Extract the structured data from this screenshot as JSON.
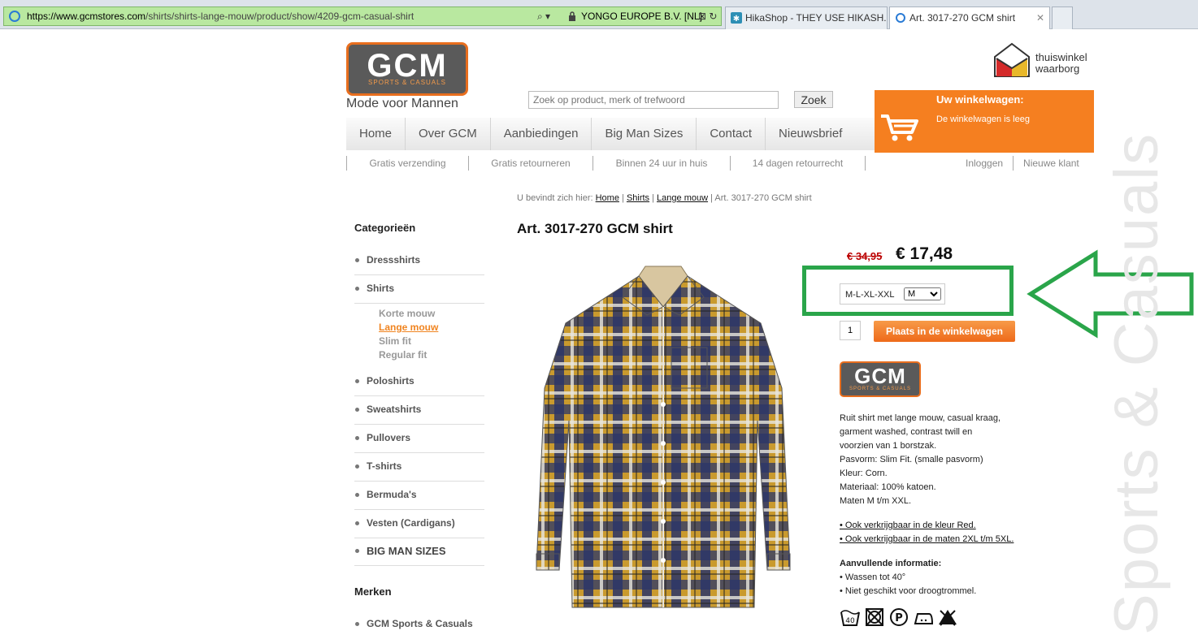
{
  "browser": {
    "url_host": "https://www.gcmstores.com",
    "url_path": "/shirts/shirts-lange-mouw/product/show/4209-gcm-casual-shirt",
    "cert": "YONGO EUROPE B.V. [NL]",
    "tabs": [
      {
        "label": "HikaShop - THEY USE HIKASH..."
      },
      {
        "label": "Art. 3017-270 GCM shirt"
      }
    ]
  },
  "header": {
    "logo_text": "GCM",
    "logo_sub": "SPORTS & CASUALS",
    "tagline": "Mode voor Mannen",
    "search_placeholder": "Zoek op product, merk of trefwoord",
    "search_button": "Zoek",
    "thuiswinkel_line1": "thuiswinkel",
    "thuiswinkel_line2": "waarborg"
  },
  "cart": {
    "title": "Uw winkelwagen:",
    "empty": "De winkelwagen is leeg"
  },
  "nav": [
    "Home",
    "Over GCM",
    "Aanbiedingen",
    "Big Man Sizes",
    "Contact",
    "Nieuwsbrief"
  ],
  "usp": [
    "Gratis verzending",
    "Gratis retourneren",
    "Binnen 24 uur in huis",
    "14 dagen retourrecht"
  ],
  "account": [
    "Inloggen",
    "Nieuwe klant"
  ],
  "breadcrumb": {
    "prefix": "U bevindt zich hier:",
    "links": [
      "Home",
      "Shirts",
      "Lange mouw"
    ],
    "current": "Art. 3017-270 GCM shirt"
  },
  "sidebar": {
    "title": "Categorieën",
    "categories": [
      "Dressshirts",
      "Shirts",
      "Poloshirts",
      "Sweatshirts",
      "Pullovers",
      "T-shirts",
      "Bermuda's",
      "Vesten (Cardigans)",
      "BIG MAN SIZES"
    ],
    "subcategories": [
      "Korte mouw",
      "Lange mouw",
      "Slim fit",
      "Regular fit"
    ],
    "brands_title": "Merken",
    "brands": [
      "GCM Sports & Casuals"
    ]
  },
  "product": {
    "title": "Art. 3017-270 GCM shirt",
    "old_price": "€ 34,95",
    "new_price": "€ 17,48",
    "size_label": "M-L-XL-XXL",
    "size_selected": "M",
    "quantity": "1",
    "add_button": "Plaats in de winkelwagen",
    "description": [
      "Ruit shirt met lange mouw, casual kraag,",
      "garment washed, contrast twill en",
      "voorzien van 1 borstzak.",
      "Pasvorm: Slim Fit. (smalle pasvorm)",
      "Kleur: Corn.",
      "Materiaal: 100% katoen.",
      "Maten M t/m XXL."
    ],
    "links": [
      "• Ook verkrijgbaar in de kleur Red.",
      "• Ook verkrijgbaar in de maten 2XL t/m 5XL."
    ],
    "extra_title": "Aanvullende informatie:",
    "extra": [
      "• Wassen tot 40°",
      "• Niet geschikt voor droogtrommel."
    ],
    "care_wash_temp": "40"
  },
  "watermark": "Sports & Casuals",
  "colors": {
    "accent_orange": "#f57f20",
    "highlight_green": "#2aa54a",
    "price_red": "#bb0000"
  }
}
